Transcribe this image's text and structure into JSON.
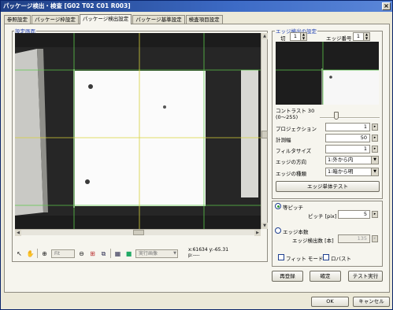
{
  "window": {
    "title": "パッケージ検出・検査 [G02 T02 C01 R003]",
    "close_label": "×"
  },
  "tabs": [
    {
      "label": "参照設定"
    },
    {
      "label": "パッケージ枠設定"
    },
    {
      "label": "パッケージ検出設定",
      "active": true
    },
    {
      "label": "パッケージ基準設定"
    },
    {
      "label": "検査項目設定"
    }
  ],
  "view": {
    "group_label": "設定画面",
    "toolbar": {
      "fit_label": "Fit",
      "mode_value": "実行画像",
      "coord_line1": "x:61634 y:-65.31",
      "coord_line2": "p:----"
    }
  },
  "edge": {
    "group_label": "エッジ検出の設定",
    "cut_label": "切",
    "cut_value": "1",
    "edge_number_label": "エッジ番号",
    "edge_number_value": "1",
    "contrast_label": "コントラスト 30",
    "contrast_range": "(0～255)",
    "contrast_value": 30,
    "projection_label": "プロジェクション",
    "projection_value": "1",
    "width_label": "計測幅",
    "width_value": "50",
    "filter_label": "フィルタサイズ",
    "filter_value": "1",
    "direction_label": "エッジの方向",
    "direction_value": "1:外から内",
    "type_label": "エッジの種類",
    "type_value": "1:暗から明",
    "test_button": "エッジ単体テスト"
  },
  "pitch": {
    "equal_pitch_label": "等ピッチ",
    "pitch_label": "ピッチ [pix]",
    "pitch_value": "5",
    "edge_count_mode_label": "エッジ本数",
    "edge_count_label": "エッジ検出数 [本]",
    "edge_count_value": "135"
  },
  "options": {
    "fit_mode_label": "フィット モード",
    "robust_label": "ロバスト"
  },
  "actions": {
    "reregister": "再登録",
    "confirm": "確定",
    "test_run": "テスト実行"
  },
  "footer": {
    "ok": "OK",
    "cancel": "キャンセル"
  },
  "colors": {
    "title_start": "#1f3f85",
    "guide_green": "#5cc84a",
    "guide_yellow": "#d8d23a",
    "group_blue": "#1a3bb0"
  }
}
